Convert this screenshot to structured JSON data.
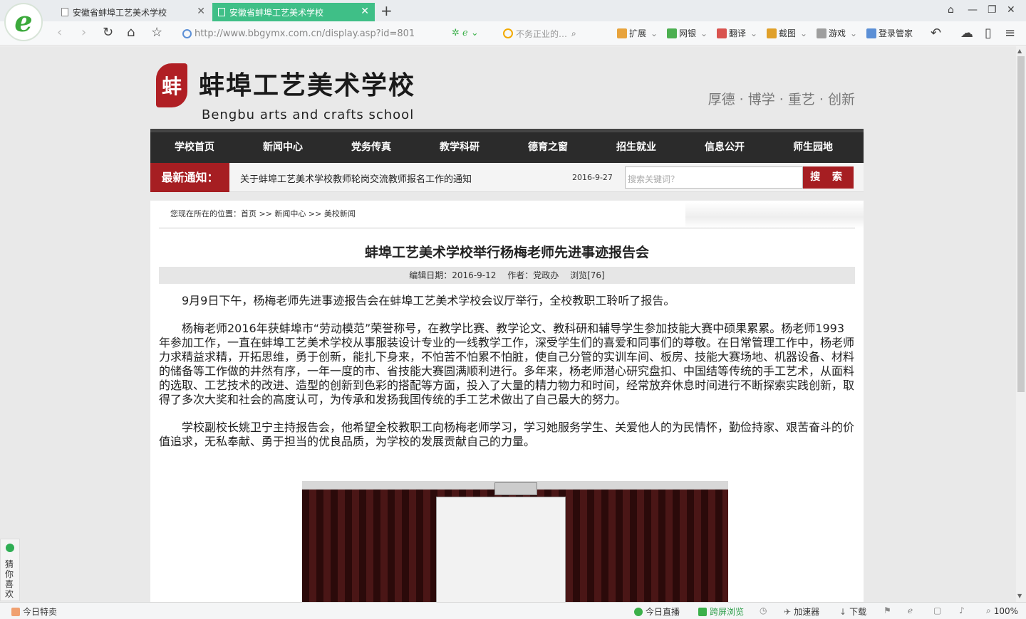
{
  "browser": {
    "logo_glyph": "e",
    "tabs": [
      {
        "title": "安徽省蚌埠工艺美术学校",
        "active": false
      },
      {
        "title": "安徽省蚌埠工艺美术学校",
        "active": true
      }
    ],
    "new_tab": "+",
    "window_controls": {
      "skin": "⌂",
      "minimize": "—",
      "maximize": "❐",
      "close": "✕"
    },
    "nav": {
      "back": "‹",
      "forward": "›",
      "refresh": "↻",
      "home": "⌂",
      "favorite": "☆"
    },
    "url": "http://www.bbgymx.com.cn/display.asp?id=801",
    "search_placeholder": "不务正业的…",
    "toolbar_items": {
      "extensions": "扩展",
      "banking": "网银",
      "translate": "翻译",
      "screenshot": "截图",
      "games": "游戏",
      "login_manager": "登录管家"
    },
    "toolbar_right": {
      "undo": "↶",
      "cloud": "☁",
      "mobile": "▯",
      "menu": "≡"
    }
  },
  "site": {
    "logo_glyph": "蚌",
    "name_cn": "蚌埠工艺美术学校",
    "name_en": "Bengbu arts and crafts school",
    "motto": "厚德 · 博学 · 重艺 · 创新",
    "nav": [
      "学校首页",
      "新闻中心",
      "党务传真",
      "教学科研",
      "德育之窗",
      "招生就业",
      "信息公开",
      "师生园地"
    ],
    "notice": {
      "label": "最新通知：",
      "text": "关于蚌埠工艺美术学校教师轮岗交流教师报名工作的通知",
      "date": "2016-9-27"
    },
    "search": {
      "placeholder": "搜索关键词？",
      "button": "搜 索"
    }
  },
  "article": {
    "breadcrumb": "您现在所在的位置：首页 >> 新闻中心 >> 美校新闻",
    "title": "蚌埠工艺美术学校举行杨梅老师先进事迹报告会",
    "meta": {
      "date": "编辑日期：2016-9-12",
      "author": "作者：党政办",
      "views": "浏览[76]"
    },
    "paragraphs": [
      "9月9日下午，杨梅老师先进事迹报告会在蚌埠工艺美术学校会议厅举行，全校教职工聆听了报告。",
      "杨梅老师2016年获蚌埠市“劳动模范”荣誉称号，在教学比赛、教学论文、教科研和辅导学生参加技能大赛中硕果累累。杨老师1993年参加工作，一直在蚌埠工艺美术学校从事服装设计专业的一线教学工作，深受学生们的喜爱和同事们的尊敬。在日常管理工作中，杨老师力求精益求精，开拓思维，勇于创新，能扎下身来，不怕苦不怕累不怕脏，使自己分管的实训车间、板房、技能大赛场地、机器设备、材料的储备等工作做的井然有序，一年一度的市、省技能大赛圆满顺利进行。多年来，杨老师潜心研究盘扣、中国结等传统的手工艺术，从面料的选取、工艺技术的改进、造型的创新到色彩的搭配等方面，投入了大量的精力物力和时间，经常放弃休息时间进行不断探索实践创新，取得了多次大奖和社会的高度认可，为传承和发扬我国传统的手工艺术做出了自己最大的努力。",
      "学校副校长姚卫宁主持报告会，他希望全校教职工向杨梅老师学习，学习她服务学生、关爱他人的为民情怀，勤俭持家、艰苦奋斗的价值追求，无私奉献、勇于担当的优良品质，为学校的发展贡献自己的力量。"
    ]
  },
  "side_widget": {
    "label": "猜你喜欢"
  },
  "statusbar": {
    "deals": "今日特卖",
    "live": "今日直播",
    "split_screen": "跨屏浏览",
    "accelerator": "加速器",
    "download": "下载",
    "zoom": "100%"
  },
  "colors": {
    "accent_red": "#a61e22",
    "nav_dark": "#2b2b2b",
    "active_tab": "#3fbf87"
  }
}
